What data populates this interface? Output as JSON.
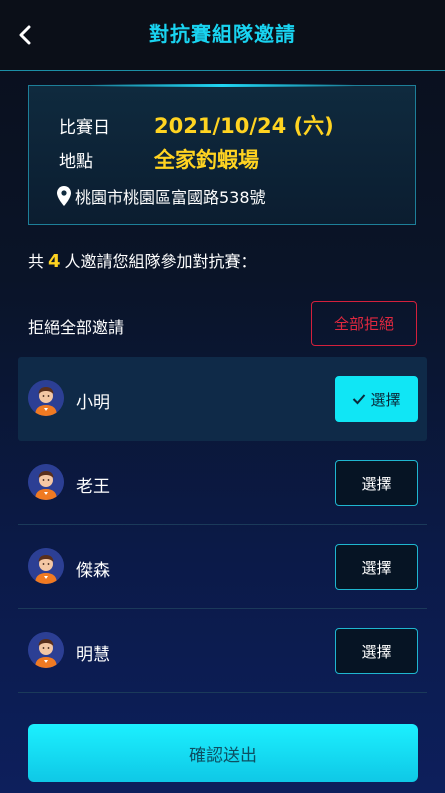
{
  "header": {
    "title": "對抗賽組隊邀請"
  },
  "event": {
    "date_label": "比賽日",
    "date_value": "2021/10/24 (六)",
    "place_label": "地點",
    "place_value": "全家釣蝦場",
    "address": "桃園市桃園區富國路538號"
  },
  "invite": {
    "prefix": "共",
    "count": "4",
    "suffix": "人邀請您組隊參加對抗賽："
  },
  "reject": {
    "label": "拒絕全部邀請",
    "button": "全部拒絕"
  },
  "players": [
    {
      "name": "小明",
      "button": "選擇",
      "selected": true
    },
    {
      "name": "老王",
      "button": "選擇",
      "selected": false
    },
    {
      "name": "傑森",
      "button": "選擇",
      "selected": false
    },
    {
      "name": "明慧",
      "button": "選擇",
      "selected": false
    }
  ],
  "confirm": {
    "label": "確認送出"
  },
  "colors": {
    "accent": "#19d3f0",
    "highlight": "#ffd321",
    "danger": "#e0283f"
  }
}
